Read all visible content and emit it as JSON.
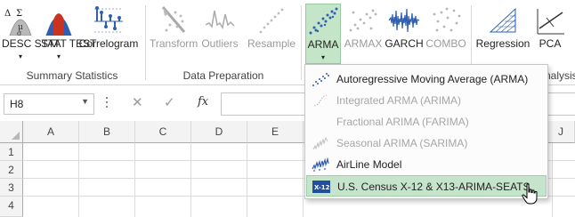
{
  "ribbon": {
    "groups": {
      "summary_statistics": "Summary Statistics",
      "data_preparation": "Data Preparation",
      "analysis_partial": "nalysis"
    },
    "buttons": {
      "desc_stat": "DESC STAT",
      "stat_test": "STAT TEST",
      "correlogram": "Correlogram",
      "transform": "Transform",
      "outliers": "Outliers",
      "resample": "Resample",
      "arma": "ARMA",
      "armax": "ARMAX",
      "garch": "GARCH",
      "combo": "COMBO",
      "regression": "Regression",
      "pca": "PCA"
    }
  },
  "formula_bar": {
    "name_box": "H8",
    "cancel_glyph": "✕",
    "enter_glyph": "✓",
    "fx_label": "fx",
    "formula_value": ""
  },
  "grid": {
    "columns": [
      "A",
      "B",
      "C",
      "D",
      "E",
      "",
      "",
      "",
      "",
      "J"
    ],
    "rows": [
      "1",
      "2",
      "3",
      "4"
    ]
  },
  "arma_menu": {
    "items": [
      {
        "label": "Autoregressive Moving Average (ARMA)",
        "enabled": true
      },
      {
        "label": "Integrated ARMA (ARIMA)",
        "enabled": false
      },
      {
        "label": "Fractional ARIMA (FARIMA)",
        "enabled": false
      },
      {
        "label": "Seasonal ARIMA (SARIMA)",
        "enabled": false
      },
      {
        "label": "AirLine Model",
        "enabled": true
      },
      {
        "label": "U.S. Census X-12 & X13-ARIMA-SEATS",
        "enabled": true,
        "highlighted": true
      }
    ]
  },
  "colors": {
    "active_button_bg": "#c5e5c9",
    "menu_highlight_bg": "#c6e4cb",
    "disabled_text": "#a6a6a6",
    "icon_blue": "#2f5fb3"
  }
}
